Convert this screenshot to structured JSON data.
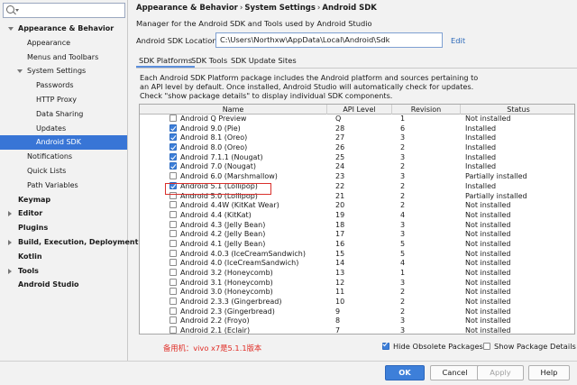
{
  "search": {
    "placeholder": ""
  },
  "sidebar": {
    "items": [
      {
        "label": "Appearance & Behavior",
        "indent": 0,
        "arrow": "down",
        "bold": true
      },
      {
        "label": "Appearance",
        "indent": 2,
        "arrow": "",
        "bold": false
      },
      {
        "label": "Menus and Toolbars",
        "indent": 2,
        "arrow": "",
        "bold": false
      },
      {
        "label": "System Settings",
        "indent": 1,
        "arrow": "down",
        "bold": false
      },
      {
        "label": "Passwords",
        "indent": 3,
        "arrow": "",
        "bold": false
      },
      {
        "label": "HTTP Proxy",
        "indent": 3,
        "arrow": "",
        "bold": false
      },
      {
        "label": "Data Sharing",
        "indent": 3,
        "arrow": "",
        "bold": false
      },
      {
        "label": "Updates",
        "indent": 3,
        "arrow": "",
        "bold": false
      },
      {
        "label": "Android SDK",
        "indent": 3,
        "arrow": "",
        "bold": false,
        "selected": true
      },
      {
        "label": "Notifications",
        "indent": 2,
        "arrow": "",
        "bold": false
      },
      {
        "label": "Quick Lists",
        "indent": 2,
        "arrow": "",
        "bold": false
      },
      {
        "label": "Path Variables",
        "indent": 2,
        "arrow": "",
        "bold": false
      },
      {
        "label": "Keymap",
        "indent": 0,
        "arrow": "",
        "bold": true
      },
      {
        "label": "Editor",
        "indent": 0,
        "arrow": "right",
        "bold": true
      },
      {
        "label": "Plugins",
        "indent": 0,
        "arrow": "",
        "bold": true
      },
      {
        "label": "Build, Execution, Deployment",
        "indent": 0,
        "arrow": "right",
        "bold": true
      },
      {
        "label": "Kotlin",
        "indent": 0,
        "arrow": "",
        "bold": true
      },
      {
        "label": "Tools",
        "indent": 0,
        "arrow": "right",
        "bold": true
      },
      {
        "label": "Android Studio",
        "indent": 0,
        "arrow": "",
        "bold": true
      }
    ]
  },
  "breadcrumb": {
    "part1": "Appearance & Behavior",
    "part2": "System Settings",
    "part3": "Android SDK",
    "sep": "›"
  },
  "description": "Manager for the Android SDK and Tools used by Android Studio",
  "sdk_location": {
    "label": "Android SDK Location:",
    "value": "C:\\Users\\Northxw\\AppData\\Local\\Android\\Sdk",
    "edit_label": "Edit"
  },
  "tabs": [
    "SDK Platforms",
    "SDK Tools",
    "SDK Update Sites"
  ],
  "platform_description": "Each Android SDK Platform package includes the Android platform and sources pertaining to an API level by default. Once installed, Android Studio will automatically check for updates. Check \"show package details\" to display individual SDK components.",
  "table": {
    "headers": [
      "Name",
      "API Level",
      "Revision",
      "Status"
    ],
    "rows": [
      {
        "checked": false,
        "name": "Android Q Preview",
        "api": "Q",
        "rev": "1",
        "status": "Not installed"
      },
      {
        "checked": true,
        "name": "Android 9.0 (Pie)",
        "api": "28",
        "rev": "6",
        "status": "Installed"
      },
      {
        "checked": true,
        "name": "Android 8.1 (Oreo)",
        "api": "27",
        "rev": "3",
        "status": "Installed"
      },
      {
        "checked": true,
        "name": "Android 8.0 (Oreo)",
        "api": "26",
        "rev": "2",
        "status": "Installed"
      },
      {
        "checked": true,
        "name": "Android 7.1.1 (Nougat)",
        "api": "25",
        "rev": "3",
        "status": "Installed"
      },
      {
        "checked": true,
        "name": "Android 7.0 (Nougat)",
        "api": "24",
        "rev": "2",
        "status": "Installed"
      },
      {
        "checked": false,
        "name": "Android 6.0 (Marshmallow)",
        "api": "23",
        "rev": "3",
        "status": "Partially installed"
      },
      {
        "checked": true,
        "name": "Android 5.1 (Lollipop)",
        "api": "22",
        "rev": "2",
        "status": "Installed"
      },
      {
        "checked": false,
        "name": "Android 5.0 (Lollipop)",
        "api": "21",
        "rev": "2",
        "status": "Partially installed"
      },
      {
        "checked": false,
        "name": "Android 4.4W (KitKat Wear)",
        "api": "20",
        "rev": "2",
        "status": "Not installed"
      },
      {
        "checked": false,
        "name": "Android 4.4 (KitKat)",
        "api": "19",
        "rev": "4",
        "status": "Not installed"
      },
      {
        "checked": false,
        "name": "Android 4.3 (Jelly Bean)",
        "api": "18",
        "rev": "3",
        "status": "Not installed"
      },
      {
        "checked": false,
        "name": "Android 4.2 (Jelly Bean)",
        "api": "17",
        "rev": "3",
        "status": "Not installed"
      },
      {
        "checked": false,
        "name": "Android 4.1 (Jelly Bean)",
        "api": "16",
        "rev": "5",
        "status": "Not installed"
      },
      {
        "checked": false,
        "name": "Android 4.0.3 (IceCreamSandwich)",
        "api": "15",
        "rev": "5",
        "status": "Not installed"
      },
      {
        "checked": false,
        "name": "Android 4.0 (IceCreamSandwich)",
        "api": "14",
        "rev": "4",
        "status": "Not installed"
      },
      {
        "checked": false,
        "name": "Android 3.2 (Honeycomb)",
        "api": "13",
        "rev": "1",
        "status": "Not installed"
      },
      {
        "checked": false,
        "name": "Android 3.1 (Honeycomb)",
        "api": "12",
        "rev": "3",
        "status": "Not installed"
      },
      {
        "checked": false,
        "name": "Android 3.0 (Honeycomb)",
        "api": "11",
        "rev": "2",
        "status": "Not installed"
      },
      {
        "checked": false,
        "name": "Android 2.3.3 (Gingerbread)",
        "api": "10",
        "rev": "2",
        "status": "Not installed"
      },
      {
        "checked": false,
        "name": "Android 2.3 (Gingerbread)",
        "api": "9",
        "rev": "2",
        "status": "Not installed"
      },
      {
        "checked": false,
        "name": "Android 2.2 (Froyo)",
        "api": "8",
        "rev": "3",
        "status": "Not installed"
      },
      {
        "checked": false,
        "name": "Android 2.1 (Eclair)",
        "api": "7",
        "rev": "3",
        "status": "Not installed"
      }
    ]
  },
  "note": "备用机：vivo x7是5.1.1版本",
  "options": {
    "hide_obsolete": "Hide Obsolete Packages",
    "hide_obsolete_checked": true,
    "show_details": "Show Package Details",
    "show_details_checked": false
  },
  "buttons": {
    "ok": "OK",
    "cancel": "Cancel",
    "apply": "Apply",
    "help": "Help"
  },
  "colors": {
    "accent": "#3d7fd9",
    "selection": "#3875d6",
    "highlight": "#d9302c",
    "link": "#2a68b8"
  }
}
